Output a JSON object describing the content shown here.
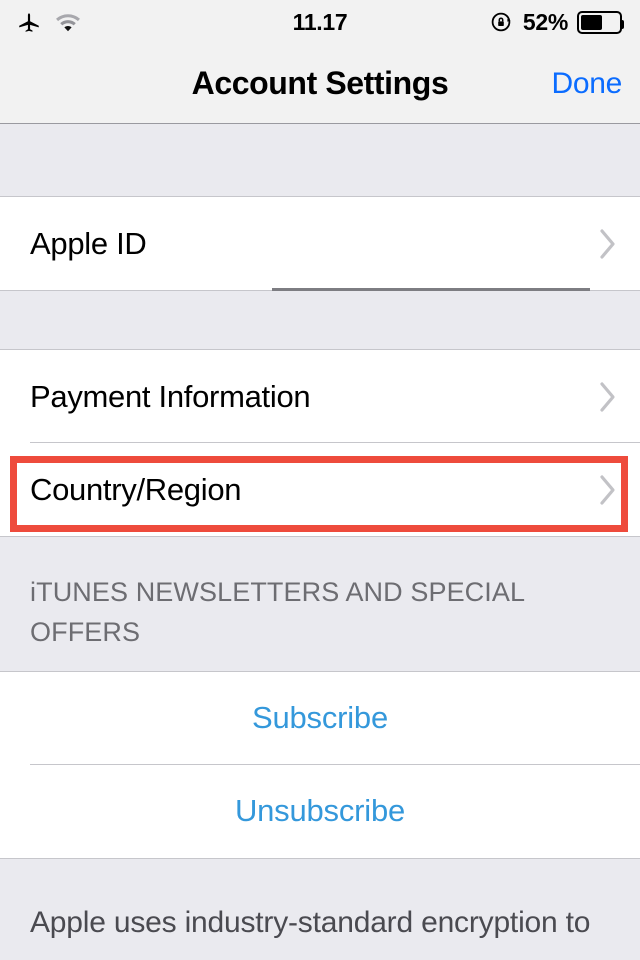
{
  "status_bar": {
    "airplane_icon": "airplane-mode-icon",
    "wifi_icon": "wifi-icon",
    "time": "11.17",
    "rotation_lock_icon": "rotation-lock-icon",
    "battery_percent_label": "52%",
    "battery_level": 52
  },
  "nav": {
    "title": "Account Settings",
    "done_label": "Done",
    "done_color": "#0B6CFF"
  },
  "sections": {
    "apple_id": {
      "rows": [
        {
          "label": "Apple ID",
          "accessory": "chevron-right-icon"
        }
      ]
    },
    "account": {
      "rows": [
        {
          "label": "Payment Information",
          "accessory": "chevron-right-icon"
        },
        {
          "label": "Country/Region",
          "accessory": "chevron-right-icon"
        }
      ]
    },
    "newsletters": {
      "header": "iTUNES NEWSLETTERS AND SPECIAL OFFERS",
      "rows": [
        {
          "label": "Subscribe"
        },
        {
          "label": "Unsubscribe"
        }
      ]
    },
    "footer": {
      "text": "Apple uses industry-standard encryption to"
    }
  },
  "highlight": {
    "target": "Country/Region",
    "color": "#EE4B3C"
  }
}
